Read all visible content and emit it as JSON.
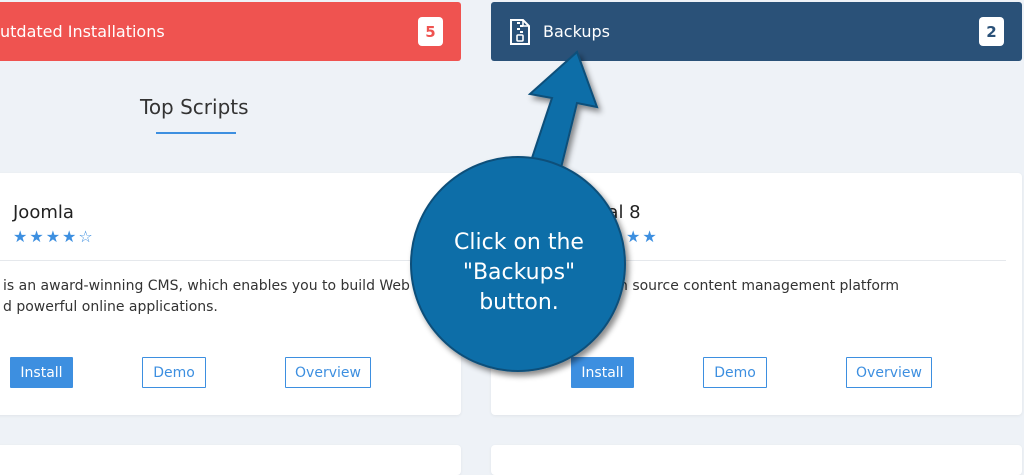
{
  "stats": {
    "outdated": {
      "label": "utdated Installations",
      "count": "5",
      "color": "#ef5350"
    },
    "backups": {
      "label": "Backups",
      "count": "2",
      "icon": "file-zip-icon",
      "color": "#2a5178"
    }
  },
  "section": {
    "title": "Top Scripts"
  },
  "scripts": [
    {
      "name": "Joomla",
      "rating_stars": "★★★★☆",
      "rating": 4.5,
      "desc_line1": "is an award-winning CMS, which enables you to build Web",
      "desc_line2": "d powerful online applications.",
      "install": "Install",
      "demo": "Demo",
      "overview": "Overview"
    },
    {
      "name": "pal 8",
      "rating_stars": "★★",
      "desc_line1": "n source content management platform",
      "install": "Install",
      "demo": "Demo",
      "overview": "Overview"
    }
  ],
  "callout": {
    "line1": "Click on the",
    "line2": "\"Backups\"",
    "line3": "button.",
    "color": "#0a6ea8"
  }
}
